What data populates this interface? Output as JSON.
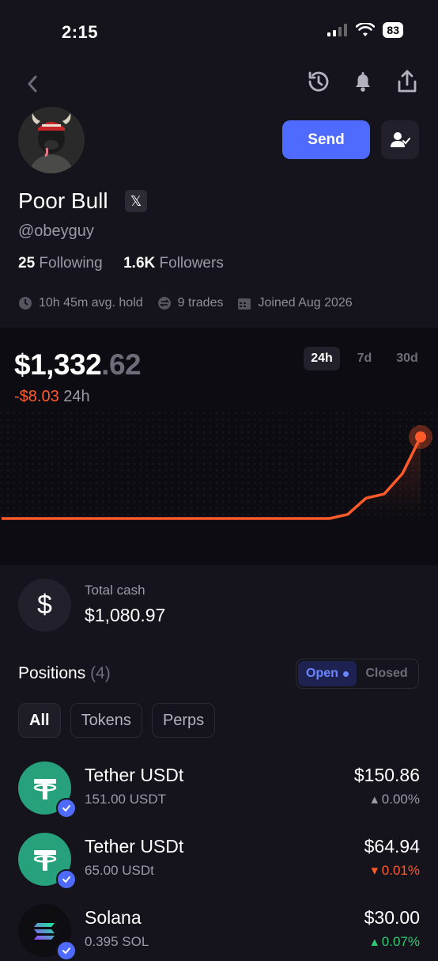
{
  "status_bar": {
    "time": "2:15",
    "battery": "83"
  },
  "header": {
    "back_icon": "chevron-left-icon",
    "icons": [
      "history-icon",
      "bell-icon",
      "share-icon"
    ]
  },
  "profile": {
    "name": "Poor Bull",
    "x_badge": "𝕏",
    "handle": "@obeyguy",
    "following_count": "25",
    "following_label": "Following",
    "followers_count": "1.6K",
    "followers_label": "Followers",
    "avg_hold": "10h 45m avg. hold",
    "trades": "9 trades",
    "joined": "Joined Aug 2026",
    "send_label": "Send"
  },
  "balance": {
    "main": "$1,332",
    "cents": ".62",
    "change_sign": "-",
    "change_value": "$8.03",
    "change_period": "24h",
    "ranges": [
      "24h",
      "7d",
      "30d"
    ],
    "active_range": "24h",
    "accent": "#ff5a2a"
  },
  "chart_data": {
    "type": "line",
    "title": "",
    "xlabel": "",
    "ylabel": "",
    "grid": false,
    "series": [
      {
        "values": [
          0,
          0,
          0,
          0,
          0,
          0,
          0,
          0,
          0,
          0,
          0,
          0,
          0,
          0,
          0,
          0,
          0,
          0,
          0,
          0.05,
          0.25,
          0.3,
          0.55,
          1.0
        ]
      }
    ]
  },
  "cash": {
    "label": "Total cash",
    "value": "$1,080.97",
    "icon": "dollar-icon"
  },
  "positions": {
    "title": "Positions",
    "count": "(4)",
    "toggle_open": "Open",
    "toggle_closed": "Closed",
    "filters": [
      "All",
      "Tokens",
      "Perps"
    ],
    "active_filter": "All",
    "items": [
      {
        "name": "Tether USDt",
        "amount": "151.00 USDT",
        "value": "$150.86",
        "change": "0.00%",
        "direction": "up-gray",
        "coin": "usdt"
      },
      {
        "name": "Tether USDt",
        "amount": "65.00 USDt",
        "value": "$64.94",
        "change": "0.01%",
        "direction": "down",
        "coin": "usdt"
      },
      {
        "name": "Solana",
        "amount": "0.395 SOL",
        "value": "$30.00",
        "change": "0.07%",
        "direction": "up-green",
        "coin": "sol"
      }
    ]
  }
}
